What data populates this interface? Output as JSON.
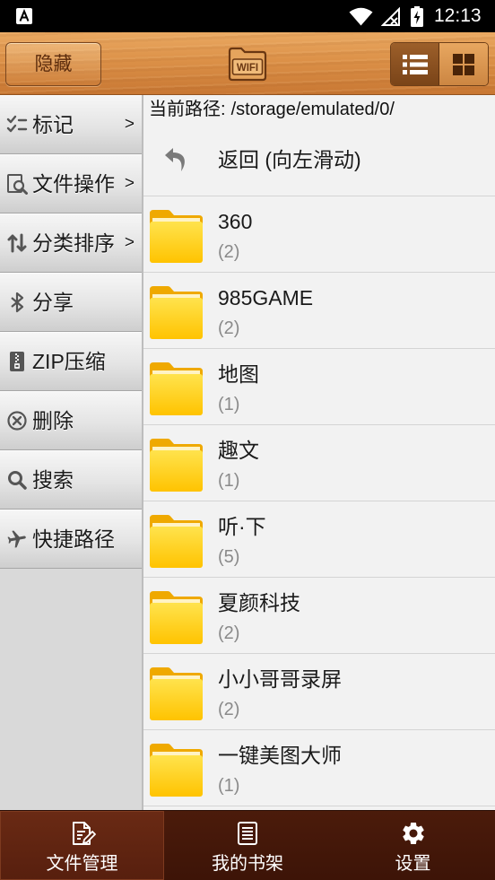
{
  "status_bar": {
    "time": "12:13",
    "icons": {
      "notification": "a-notification-icon",
      "wifi": "wifi-icon",
      "signal": "no-signal-icon",
      "battery": "battery-charging-icon"
    }
  },
  "header": {
    "hide_button": "隐藏",
    "wifi_icon": "wifi-transfer-folder-icon",
    "wifi_label": "WIFI",
    "view_modes": [
      {
        "icon": "list-view-icon",
        "selected": true
      },
      {
        "icon": "grid-view-icon",
        "selected": false
      }
    ]
  },
  "sidebar": {
    "items": [
      {
        "label": "标记",
        "arrow": ">",
        "icon": "checklist-icon"
      },
      {
        "label": "文件操作",
        "arrow": ">",
        "icon": "file-search-icon"
      },
      {
        "label": "分类排序",
        "arrow": ">",
        "icon": "sort-icon"
      },
      {
        "label": "分享",
        "icon": "bluetooth-icon"
      },
      {
        "label": "ZIP压缩",
        "icon": "zip-icon"
      },
      {
        "label": "删除",
        "icon": "delete-icon"
      },
      {
        "label": "搜索",
        "icon": "search-icon"
      },
      {
        "label": "快捷路径",
        "icon": "airplane-icon"
      }
    ]
  },
  "main": {
    "path_label": "当前路径:",
    "path_value": "/storage/emulated/0/",
    "back_row": {
      "label": "返回 (向左滑动)",
      "icon": "back-arrow-icon"
    },
    "folders": [
      {
        "name": "360",
        "count": "(2)"
      },
      {
        "name": "985GAME",
        "count": "(2)"
      },
      {
        "name": "地图",
        "count": "(1)"
      },
      {
        "name": "趣文",
        "count": "(1)"
      },
      {
        "name": "听·下",
        "count": "(5)"
      },
      {
        "name": "夏颜科技",
        "count": "(2)"
      },
      {
        "name": "小小哥哥录屏",
        "count": "(2)"
      },
      {
        "name": "一键美图大师",
        "count": "(1)"
      }
    ]
  },
  "bottom_nav": {
    "tabs": [
      {
        "label": "文件管理",
        "icon": "file-manager-icon",
        "selected": true
      },
      {
        "label": "我的书架",
        "icon": "bookshelf-icon",
        "selected": false
      },
      {
        "label": "设置",
        "icon": "gear-icon",
        "selected": false
      }
    ]
  },
  "colors": {
    "status_bar": "#000000",
    "header_wood_light": "#eaa962",
    "header_wood_dark": "#c87733",
    "folder_yellow": "#ffcc00",
    "sidebar_bg": "#d9d9d9",
    "content_bg": "#f2f2f2",
    "bottom_nav": "#451909",
    "bottom_nav_selected": "#5f2410",
    "text_primary": "#1a1a1a",
    "text_secondary": "#8a8a8a"
  }
}
